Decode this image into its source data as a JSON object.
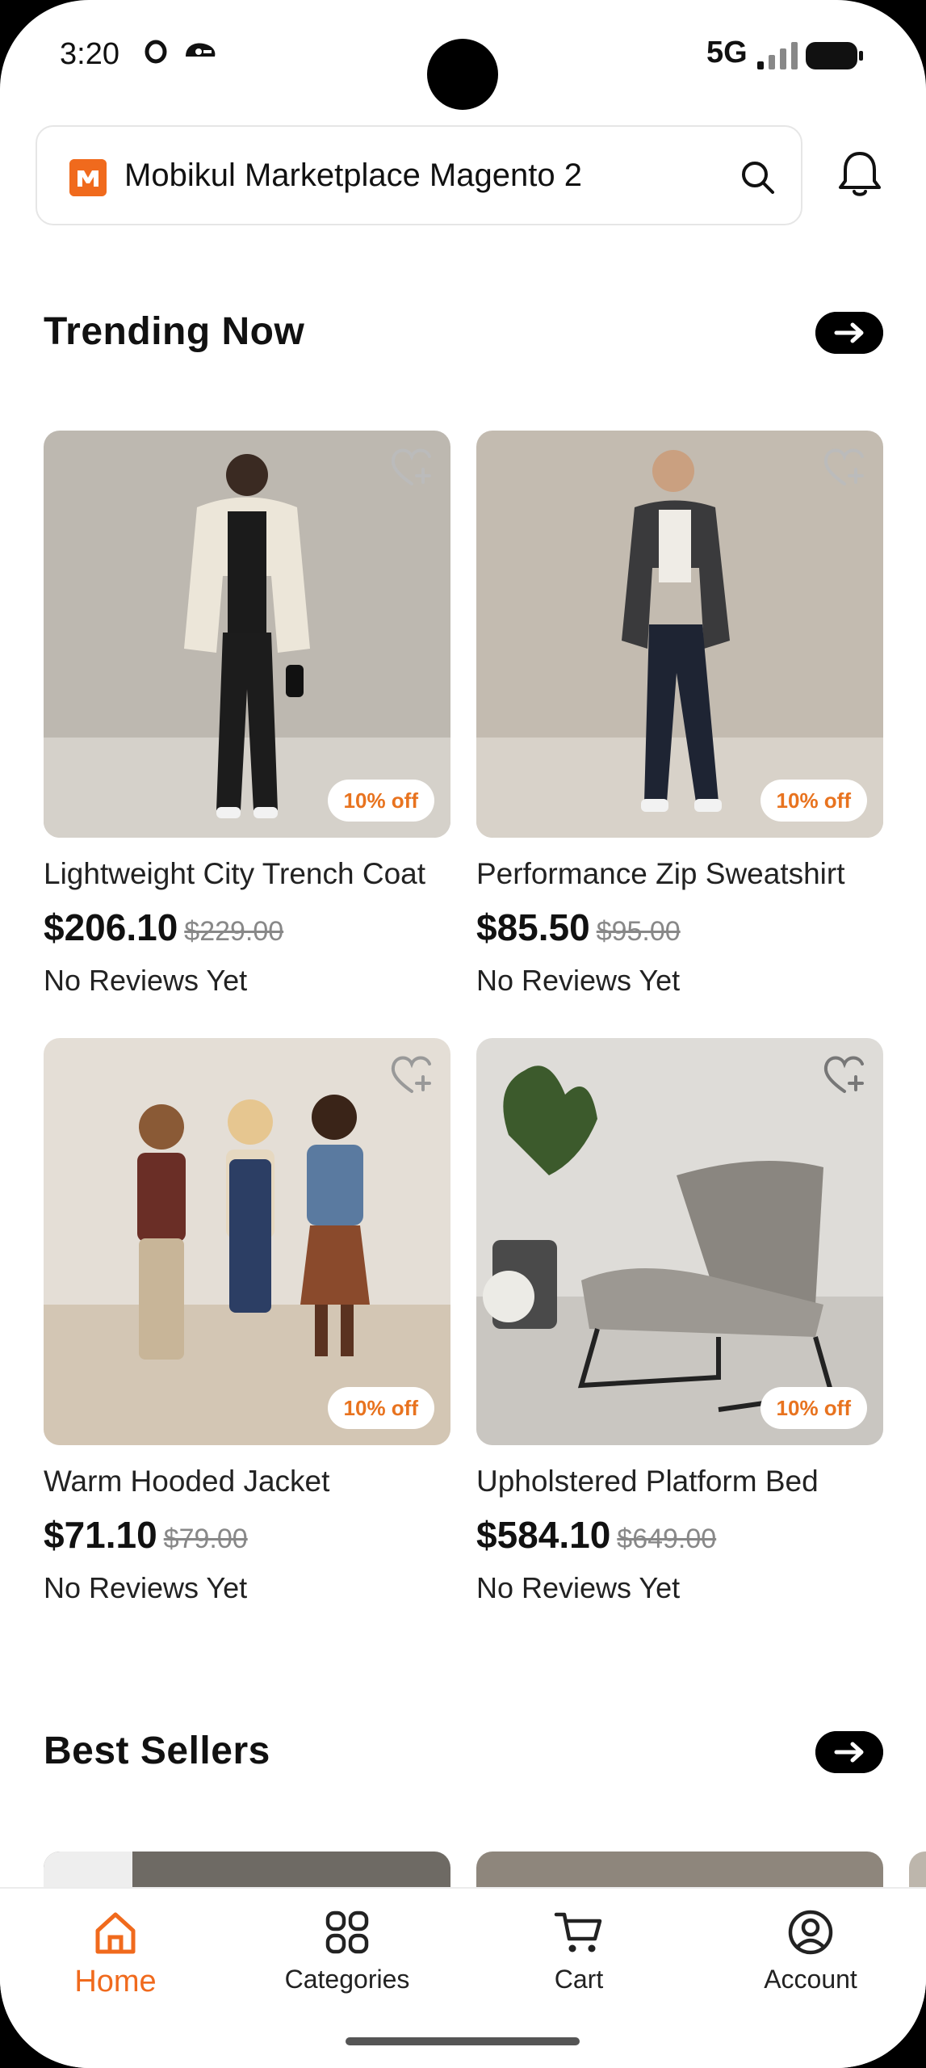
{
  "status_bar": {
    "time": "3:20",
    "network": "5G"
  },
  "search": {
    "title": "Mobikul Marketplace Magento 2"
  },
  "colors": {
    "accent": "#f06a1d",
    "badge_text": "#e8731f"
  },
  "sections": {
    "trending": {
      "title": "Trending Now",
      "products": [
        {
          "name": "Lightweight City Trench Coat",
          "price": "$206.10",
          "old_price": "$229.00",
          "discount": "10% off",
          "reviews": "No Reviews Yet"
        },
        {
          "name": "Performance Zip Sweatshirt",
          "price": "$85.50",
          "old_price": "$95.00",
          "discount": "10% off",
          "reviews": "No Reviews Yet"
        },
        {
          "name": "Warm Hooded Jacket",
          "price": "$71.10",
          "old_price": "$79.00",
          "discount": "10% off",
          "reviews": "No Reviews Yet"
        },
        {
          "name": "Upholstered Platform Bed",
          "price": "$584.10",
          "old_price": "$649.00",
          "discount": "10% off",
          "reviews": "No Reviews Yet"
        }
      ]
    },
    "best_sellers": {
      "title": "Best Sellers"
    }
  },
  "nav": [
    {
      "label": "Home",
      "icon": "home-icon",
      "active": true
    },
    {
      "label": "Categories",
      "icon": "categories-icon",
      "active": false
    },
    {
      "label": "Cart",
      "icon": "cart-icon",
      "active": false
    },
    {
      "label": "Account",
      "icon": "account-icon",
      "active": false
    }
  ]
}
